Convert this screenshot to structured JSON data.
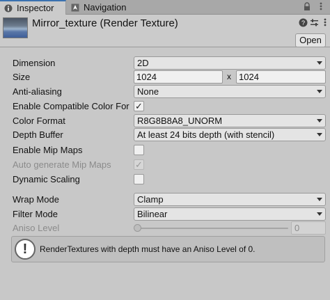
{
  "tabs": [
    {
      "label": "Inspector",
      "icon": "info-icon"
    },
    {
      "label": "Navigation",
      "icon": "navigation-icon"
    }
  ],
  "header": {
    "title": "Mirror_texture (Render Texture)",
    "open_label": "Open"
  },
  "fields": {
    "dimension": {
      "label": "Dimension",
      "value": "2D"
    },
    "size": {
      "label": "Size",
      "width": "1024",
      "separator": "x",
      "height": "1024"
    },
    "anti_aliasing": {
      "label": "Anti-aliasing",
      "value": "None"
    },
    "compat_color": {
      "label": "Enable Compatible Color For",
      "checked": true
    },
    "color_format": {
      "label": "Color Format",
      "value": "R8G8B8A8_UNORM"
    },
    "depth_buffer": {
      "label": "Depth Buffer",
      "value": "At least 24 bits depth (with stencil)"
    },
    "mip_maps": {
      "label": "Enable Mip Maps",
      "checked": false
    },
    "auto_mip": {
      "label": "Auto generate Mip Maps",
      "checked": true,
      "disabled": true
    },
    "dynamic_scaling": {
      "label": "Dynamic Scaling",
      "checked": false
    },
    "wrap_mode": {
      "label": "Wrap Mode",
      "value": "Clamp"
    },
    "filter_mode": {
      "label": "Filter Mode",
      "value": "Bilinear"
    },
    "aniso_level": {
      "label": "Aniso Level",
      "value": "0",
      "disabled": true
    }
  },
  "help": {
    "icon": "warning-icon",
    "text": "RenderTextures with depth must have an Aniso Level of 0."
  },
  "check_glyph": "✓",
  "help_glyph": "!"
}
